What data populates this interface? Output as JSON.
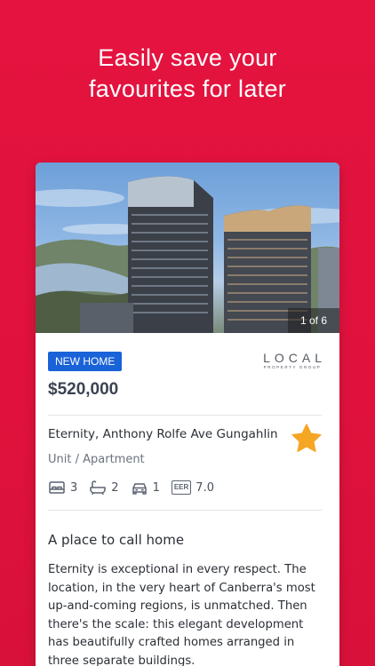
{
  "headline": {
    "line1": "Easily save your",
    "line2": "favourites for later"
  },
  "listing": {
    "photo_counter": "1 of 6",
    "badge": "NEW HOME",
    "agency": {
      "name": "LOCAL",
      "tagline": "PROPERTY GROUP"
    },
    "price": "$520,000",
    "address": "Eternity, Anthony Rolfe Ave Gungahlin",
    "property_type": "Unit / Apartment",
    "favourite_icon": "star-icon",
    "features": {
      "bedrooms": "3",
      "bathrooms": "2",
      "car_spaces": "1",
      "eer_label": "EER",
      "eer_value": "7.0"
    },
    "section_title": "A place to call home",
    "description": "Eternity is exceptional in every respect. The location, in the very heart of Canberra's most up-and-coming regions, is unmatched. Then there's the scale: this elegant development has beautifully crafted homes arranged in three separate buildings."
  },
  "colors": {
    "background": "#e4133f",
    "badge": "#1a62d8",
    "star": "#f5a623",
    "price_text": "#3b4351"
  }
}
